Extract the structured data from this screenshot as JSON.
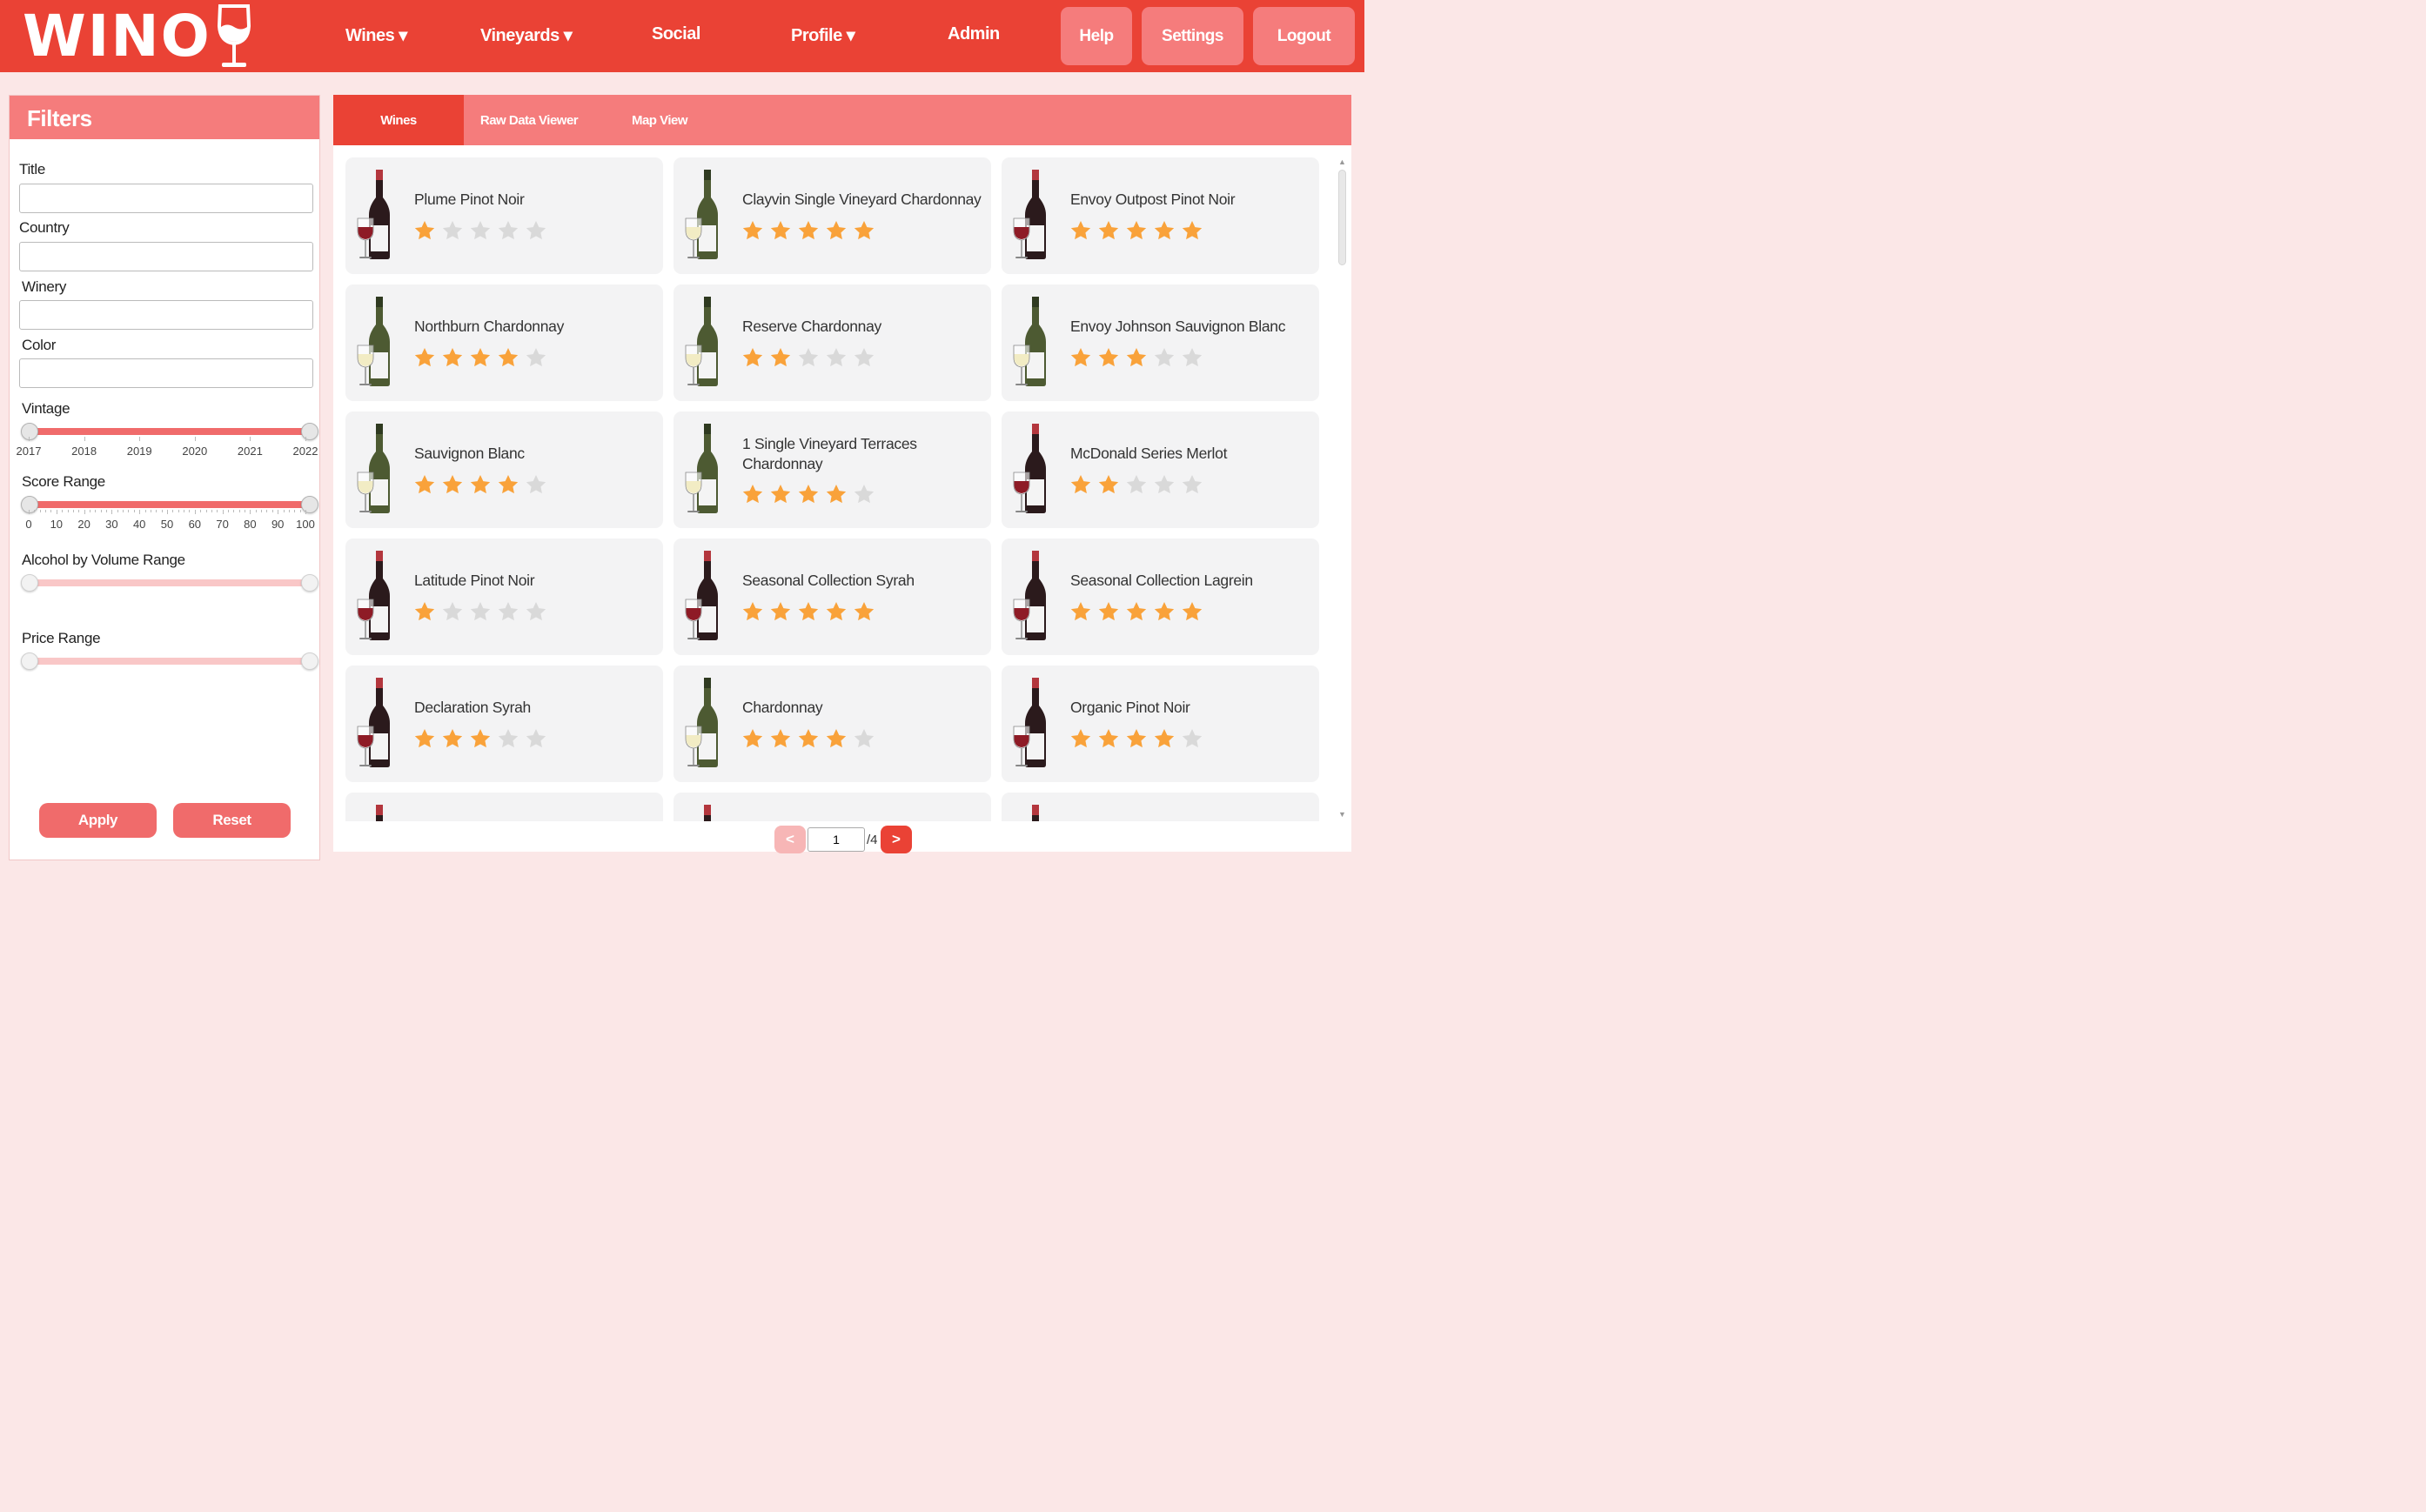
{
  "header": {
    "logo_text": "WINO",
    "nav": [
      "Wines ▾",
      "Vineyards ▾",
      "Social",
      "Profile ▾",
      "Admin"
    ],
    "buttons": [
      "Help",
      "Settings",
      "Logout"
    ]
  },
  "filters": {
    "title": "Filters",
    "labels": {
      "title": "Title",
      "country": "Country",
      "winery": "Winery",
      "color": "Color",
      "vintage": "Vintage",
      "score": "Score Range",
      "abv": "Alcohol by Volume Range",
      "price": "Price Range"
    },
    "inputs": {
      "title": "",
      "country": "",
      "winery": "",
      "color": ""
    },
    "vintage_ticks": [
      "2017",
      "2018",
      "2019",
      "2020",
      "2021",
      "2022"
    ],
    "vintage_range": [
      2017,
      2022
    ],
    "score_ticks": [
      "0",
      "10",
      "20",
      "30",
      "40",
      "50",
      "60",
      "70",
      "80",
      "90",
      "100"
    ],
    "score_range": [
      0,
      100
    ],
    "apply": "Apply",
    "reset": "Reset"
  },
  "tabs": [
    "Wines",
    "Raw Data Viewer",
    "Map View"
  ],
  "active_tab": "Wines",
  "colors": {
    "red": "#ea4235",
    "accent": "#f57c7c",
    "star": "#f9a23a",
    "star_empty": "#d9d9d9"
  },
  "wines": [
    {
      "name": "Plume Pinot Noir",
      "type": "red",
      "rating": 1
    },
    {
      "name": "Clayvin Single Vineyard Chardonnay",
      "type": "white",
      "rating": 5
    },
    {
      "name": "Envoy Outpost Pinot Noir",
      "type": "red",
      "rating": 5
    },
    {
      "name": "Northburn Chardonnay",
      "type": "white",
      "rating": 4
    },
    {
      "name": "Reserve Chardonnay",
      "type": "white",
      "rating": 2
    },
    {
      "name": "Envoy Johnson Sauvignon Blanc",
      "type": "white",
      "rating": 3
    },
    {
      "name": "Sauvignon Blanc",
      "type": "white",
      "rating": 4
    },
    {
      "name": "1 Single Vineyard Terraces Chardonnay",
      "type": "white",
      "rating": 4
    },
    {
      "name": "McDonald Series Merlot",
      "type": "red",
      "rating": 2
    },
    {
      "name": "Latitude Pinot Noir",
      "type": "red",
      "rating": 1
    },
    {
      "name": "Seasonal Collection Syrah",
      "type": "red",
      "rating": 5
    },
    {
      "name": "Seasonal Collection Lagrein",
      "type": "red",
      "rating": 5
    },
    {
      "name": "Declaration Syrah",
      "type": "red",
      "rating": 3
    },
    {
      "name": "Chardonnay",
      "type": "white",
      "rating": 4
    },
    {
      "name": "Organic Pinot Noir",
      "type": "red",
      "rating": 4
    },
    {
      "name": "",
      "type": "red",
      "rating": 0
    },
    {
      "name": "",
      "type": "red",
      "rating": 0
    },
    {
      "name": "",
      "type": "red",
      "rating": 0
    }
  ],
  "pagination": {
    "prev": "<",
    "next": ">",
    "page": "1",
    "total": "/4"
  }
}
